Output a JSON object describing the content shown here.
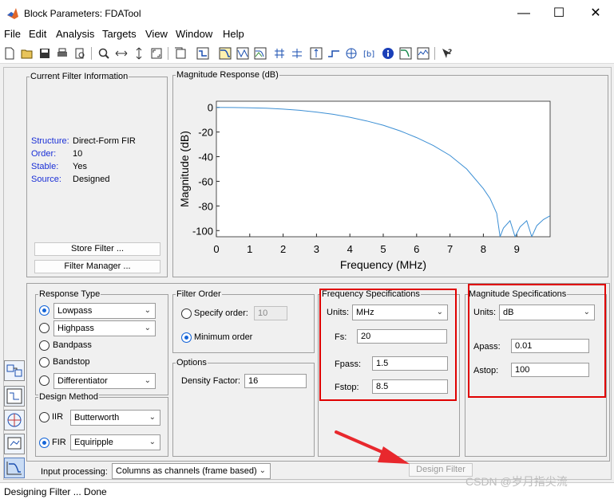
{
  "window": {
    "title": "Block Parameters: FDATool"
  },
  "menu": [
    "File",
    "Edit",
    "Analysis",
    "Targets",
    "View",
    "Window",
    "Help"
  ],
  "toolbar_icons": [
    "new-icon",
    "open-icon",
    "save-icon",
    "print-icon",
    "print-preview-icon",
    "zoom-in-icon",
    "zoom-x-icon",
    "zoom-y-icon",
    "full-view-icon",
    "new-figure-icon",
    "filter-specs-icon",
    "magnitude-icon",
    "phase-icon",
    "mag-phase-icon",
    "group-delay-icon",
    "phase-delay-icon",
    "impulse-icon",
    "step-icon",
    "pole-zero-icon",
    "coefficients-icon",
    "info-icon",
    "magnitude-estimate-icon",
    "noise-icon",
    "whats-this-icon"
  ],
  "current_filter": {
    "legend": "Current Filter Information",
    "rows": [
      {
        "label": "Structure:",
        "value": "Direct-Form FIR"
      },
      {
        "label": "Order:",
        "value": "10"
      },
      {
        "label": "Stable:",
        "value": "Yes"
      },
      {
        "label": "Source:",
        "value": "Designed"
      }
    ],
    "store_button": "Store Filter ...",
    "manager_button": "Filter Manager ..."
  },
  "magnitude_panel": {
    "legend": "Magnitude Response (dB)"
  },
  "chart_data": {
    "type": "line",
    "xlabel": "Frequency (MHz)",
    "ylabel": "Magnitude (dB)",
    "xlim": [
      0,
      10
    ],
    "ylim": [
      -105,
      5
    ],
    "x_ticks": [
      "0",
      "1",
      "2",
      "3",
      "4",
      "5",
      "6",
      "7",
      "8",
      "9"
    ],
    "y_ticks": [
      "0",
      "-20",
      "-40",
      "-60",
      "-80",
      "-100"
    ],
    "grid": false,
    "color": "#3c8fd4",
    "x": [
      0,
      0.5,
      1,
      1.5,
      2,
      2.5,
      3,
      3.5,
      4,
      4.5,
      5,
      5.5,
      6,
      6.5,
      7,
      7.5,
      8,
      8.2,
      8.4,
      8.5,
      8.6,
      8.8,
      8.95,
      9.1,
      9.3,
      9.45,
      9.6,
      9.8,
      10
    ],
    "y": [
      0,
      -0.1,
      -0.3,
      -0.7,
      -1.4,
      -2.4,
      -3.8,
      -5.6,
      -8,
      -11,
      -14.5,
      -19,
      -24.5,
      -31,
      -39,
      -50,
      -66,
      -74,
      -86,
      -105,
      -98,
      -92,
      -105,
      -97,
      -92,
      -105,
      -96,
      -91,
      -88
    ]
  },
  "response_type": {
    "legend": "Response Type",
    "options": [
      {
        "label": "Lowpass",
        "kind": "select",
        "selected": true
      },
      {
        "label": "Highpass",
        "kind": "select",
        "selected": false
      },
      {
        "label": "Bandpass",
        "kind": "text",
        "selected": false
      },
      {
        "label": "Bandstop",
        "kind": "text",
        "selected": false
      },
      {
        "label": "Differentiator",
        "kind": "select",
        "selected": false
      }
    ]
  },
  "design_method": {
    "legend": "Design Method",
    "iir": {
      "label": "IIR",
      "value": "Butterworth",
      "selected": false
    },
    "fir": {
      "label": "FIR",
      "value": "Equiripple",
      "selected": true
    }
  },
  "filter_order": {
    "legend": "Filter Order",
    "specify_label": "Specify order:",
    "specify_value": "10",
    "minimum_label": "Minimum order"
  },
  "options": {
    "legend": "Options",
    "density_label": "Density Factor:",
    "density_value": "16"
  },
  "freq_specs": {
    "legend": "Frequency Specifications",
    "units_label": "Units:",
    "units_value": "MHz",
    "fs_label": "Fs:",
    "fs_value": "20",
    "fpass_label": "Fpass:",
    "fpass_value": "1.5",
    "fstop_label": "Fstop:",
    "fstop_value": "8.5"
  },
  "mag_specs": {
    "legend": "Magnitude Specifications",
    "units_label": "Units:",
    "units_value": "dB",
    "apass_label": "Apass:",
    "apass_value": "0.01",
    "astop_label": "Astop:",
    "astop_value": "100"
  },
  "input_processing": {
    "label": "Input processing:",
    "value": "Columns as channels (frame based)"
  },
  "design_button": "Design Filter",
  "status": "Designing Filter ... Done",
  "watermark": "CSDN @岁月指尖流",
  "colors": {
    "highlight": "#e00000",
    "arrow": "#e8282d",
    "label_blue": "#1a2fd6",
    "plot_line": "#3c8fd4"
  }
}
